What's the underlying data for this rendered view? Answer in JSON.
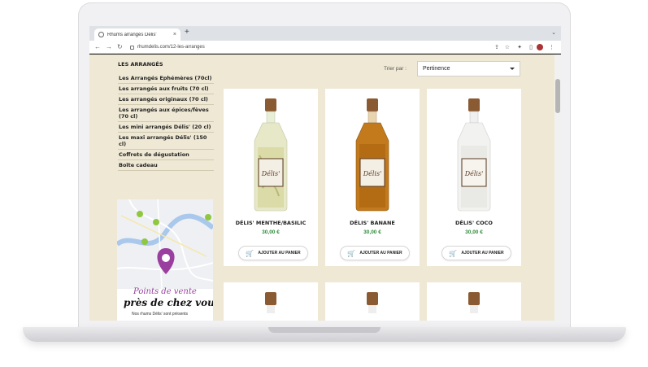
{
  "browser": {
    "tab_title": "Rhums arrangés Délis'",
    "tab_close": "×",
    "new_tab": "+",
    "tab_menu": "⌄",
    "url": "rhumdelis.com/12-les-arranges"
  },
  "sidebar": {
    "title": "LES ARRANGÉS",
    "items": [
      {
        "label": "Les Arrangés Ephémères (70cl)"
      },
      {
        "label": "Les arrangés aux fruits (70 cl)"
      },
      {
        "label": "Les arrangés originaux (70 cl)"
      },
      {
        "label": "Les arrangés aux épices/fèves (70 cl)"
      },
      {
        "label": "Les mini arrangés Délis' (20 cl)"
      },
      {
        "label": "Les maxi arrangés Délis' (150 cl)"
      },
      {
        "label": "Coffrets de dégustation"
      },
      {
        "label": "Boîte cadeau"
      }
    ]
  },
  "map_banner": {
    "line1": "Points de vente",
    "line2": "près de chez vous",
    "line3": "Nos rhums Délis' sont présents"
  },
  "sort": {
    "label": "Trier par :",
    "selected": "Pertinence"
  },
  "products": [
    {
      "name": "DÉLIS' MENTHE/BASILIC",
      "price": "30,00 €",
      "button": "AJOUTER AU PANIER"
    },
    {
      "name": "DÉLIS' BANANE",
      "price": "30,00 €",
      "button": "AJOUTER AU PANIER"
    },
    {
      "name": "DÉLIS' COCO",
      "price": "30,00 €",
      "button": "AJOUTER AU PANIER"
    }
  ],
  "bottle_label": "Délis'",
  "colors": {
    "page_bg": "#eee8d4",
    "price": "#2f8a3a",
    "accent": "#9a3fa0",
    "map_pin": "#8fc73e"
  }
}
